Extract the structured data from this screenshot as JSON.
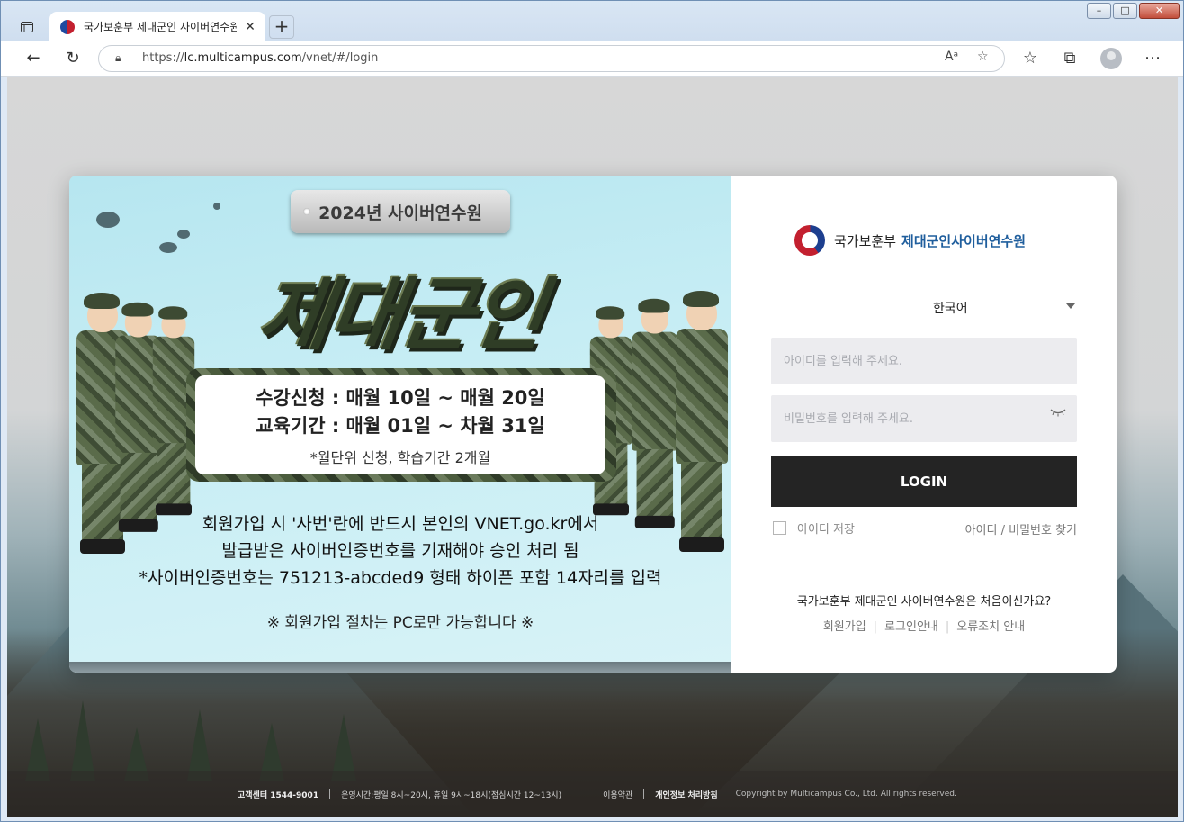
{
  "browser": {
    "tab_title": "국가보훈부 제대군인 사이버연수원",
    "url_prefix": "https://",
    "url_host": "lc.multicampus.com",
    "url_path": "/vnet/#/login",
    "window_min": "–",
    "window_max": "□",
    "window_close": "✕",
    "new_tab": "+"
  },
  "banner": {
    "badge": "2024년 사이버연수원",
    "headline": "제대군인",
    "info_line1": "수강신청 : 매월 10일 ~ 매월 20일",
    "info_line2": "교육기간 : 매월 01일 ~ 차월 31일",
    "info_sub": "*월단위 신청, 학습기간 2개월",
    "notice_line1": "회원가입 시 '사번'란에 반드시 본인의 VNET.go.kr에서",
    "notice_line2": "발급받은 사이버인증번호를 기재해야 승인 처리 됨",
    "notice_line3": "*사이버인증번호는 751213-abcded9 형태 하이픈 포함 14자리를 입력",
    "notice_pc": "※ 회원가입 절차는 PC로만 가능합니다 ※"
  },
  "login": {
    "logo_ministry": "국가보훈부",
    "logo_institute": "제대군인사이버연수원",
    "language": "한국어",
    "id_placeholder": "아이디를 입력해 주세요.",
    "password_placeholder": "비밀번호를 입력해 주세요.",
    "login_button": "LOGIN",
    "remember_id": "아이디 저장",
    "find_account": "아이디 / 비밀번호 찾기",
    "first_time": "국가보훈부 제대군인 사이버연수원은 처음이신가요?",
    "signup": "회원가입",
    "login_guide": "로그인안내",
    "error_guide": "오류조치 안내"
  },
  "footer": {
    "support": "고객센터 1544-9001",
    "hours": "운영시간:평일 8시~20시, 휴일 9시~18시(점심시간 12~13시)",
    "terms": "이용약관",
    "privacy": "개인정보 처리방침",
    "copyright": "Copyright by Multicampus Co., Ltd. All rights reserved."
  }
}
